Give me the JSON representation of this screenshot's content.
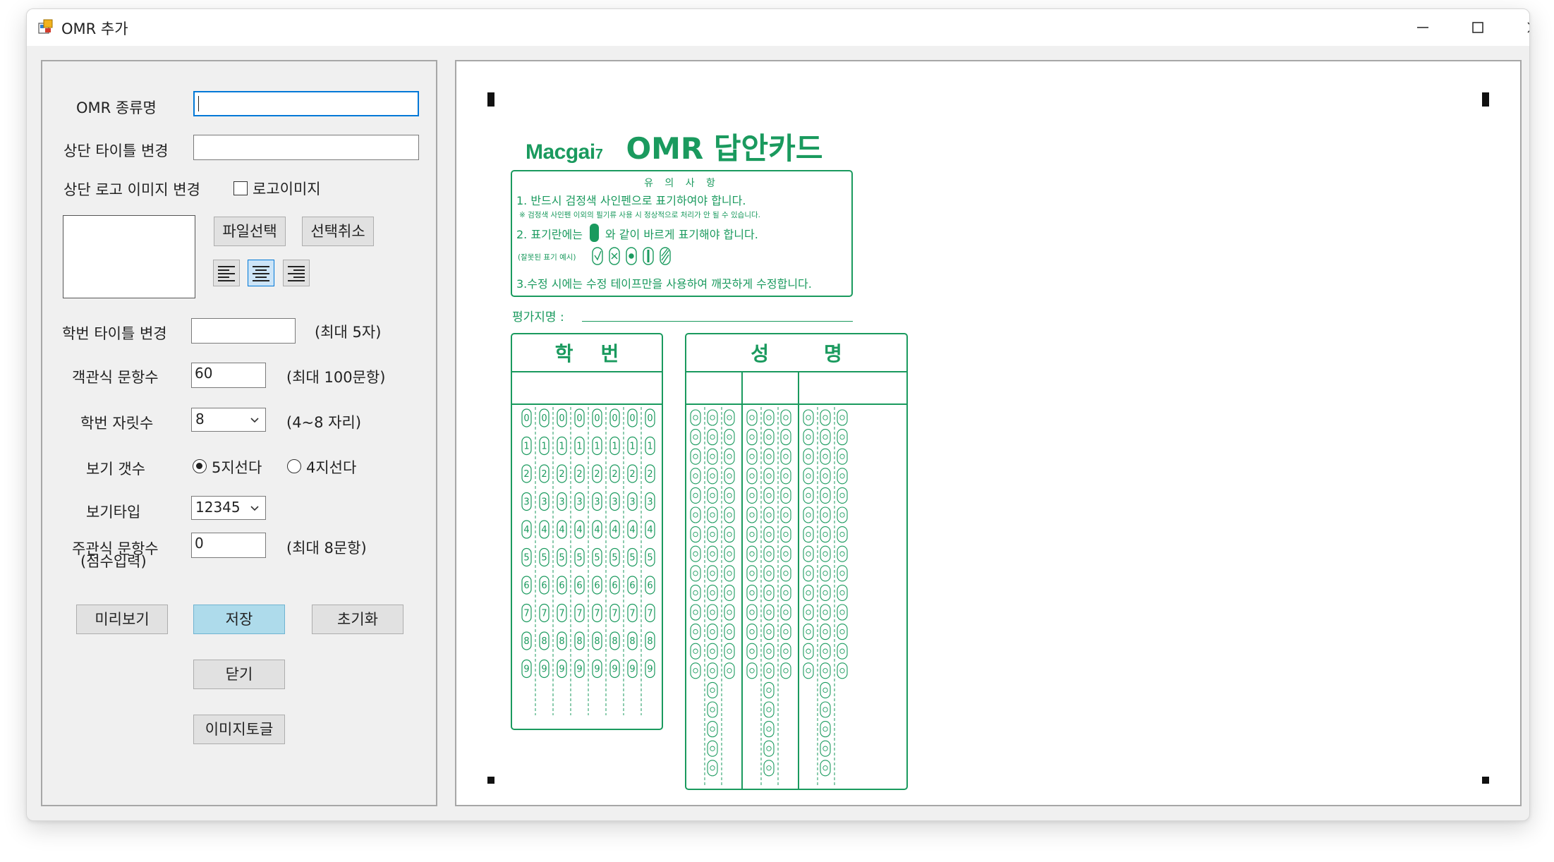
{
  "window": {
    "title": "OMR 추가"
  },
  "form": {
    "omr_type_label": "OMR 종류명",
    "omr_type_value": "",
    "top_title_label": "상단 타이틀 변경",
    "top_title_value": "",
    "logo_label": "상단 로고 이미지 변경",
    "logo_checkbox_label": "로고이미지",
    "logo_checkbox_checked": false,
    "file_select_button": "파일선택",
    "cancel_select_button": "선택취소",
    "alignment_selected": "center",
    "student_id_title_label": "학번 타이틀 변경",
    "student_id_title_value": "",
    "student_id_title_hint": "(최대 5자)",
    "objective_count_label": "객관식 문항수",
    "objective_count_value": "60",
    "objective_count_hint": "(최대 100문항)",
    "id_digits_label": "학번 자릿수",
    "id_digits_value": "8",
    "id_digits_hint": "(4~8 자리)",
    "choice_count_label": "보기 갯수",
    "choice_5_label": "5지선다",
    "choice_4_label": "4지선다",
    "choice_selected": "5지선다",
    "choice_type_label": "보기타입",
    "choice_type_value": "12345",
    "subjective_label_line1": "주관식 문항수",
    "subjective_label_line2": "(점수입력)",
    "subjective_value": "0",
    "subjective_hint": "(최대 8문항)"
  },
  "buttons": {
    "preview": "미리보기",
    "save": "저장",
    "reset": "초기화",
    "close": "닫기",
    "image_toggle": "이미지토글"
  },
  "omr_preview": {
    "brand_main": "Macgai",
    "brand_suffix": "7",
    "card_title": "OMR 답안카드",
    "notice_heading": "유 의 사 항",
    "notice_line1": "1. 반드시 검정색 사인펜으로 표기하여야 합니다.",
    "notice_line1_sub": "※ 검정색 사인펜 이외의 필기류 사용 시 정상적으로 처리가 안 될 수 있습니다.",
    "notice_line2_before": "2. 표기란에는",
    "notice_line2_after": "와 같이 바르게 표기해야 합니다.",
    "notice_wrong_example": "(잘못된 표기 예시)",
    "notice_line3": "3.수정 시에는 수정 테이프만을 사용하여 깨끗하게 수정합니다.",
    "evaluator_label": "평가지명 :",
    "student_id_header": "학    번",
    "name_header": "성        명",
    "id_columns": 8,
    "id_digits": [
      "0",
      "1",
      "2",
      "3",
      "4",
      "5",
      "6",
      "7",
      "8",
      "9"
    ],
    "name_columns": 9,
    "name_row_count": 14,
    "name_extra_rows": 5,
    "accent_color": "#1a9a5e"
  },
  "colors": {
    "accent_green": "#1a9a5e",
    "save_highlight": "#aedbeb",
    "focus_border": "#0078d7"
  }
}
